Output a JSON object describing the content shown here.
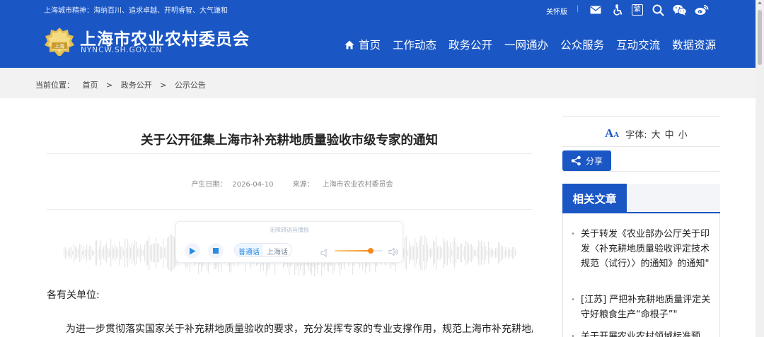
{
  "header": {
    "motto": "上海城市精神：海纳百川、追求卓越、开明睿智、大气谦和",
    "care_mode": "关怀版",
    "separator": "|",
    "icons": [
      "mail-icon",
      "accessibility-icon",
      "traditional-chinese-icon",
      "search-icon",
      "wechat-icon",
      "weibo-icon"
    ],
    "traditional_char": "繁",
    "site_title": "上海市农业农村委员会",
    "site_domain": "NYNCW.SH.GOV.CN",
    "logo_text": "上海",
    "nav": [
      "首页",
      "工作动态",
      "政务公开",
      "一网通办",
      "公众服务",
      "互动交流",
      "数据资源"
    ]
  },
  "breadcrumb": {
    "label": "当前位置：",
    "items": [
      "首页",
      "政务公开",
      "公示公告"
    ],
    "separator": ">"
  },
  "article": {
    "title": "关于公开征集上海市补充耕地质量验收市级专家的通知",
    "date_label": "产生日期：",
    "date": "2026-04-10",
    "source_label": "来源：",
    "source": "上海市农业农村委员会",
    "salutation": "各有关单位:",
    "paragraph": "为进一步贯彻落实国家关于补充耕地质量验收的要求，充分发挥专家的专业支撑作用，规范上海市补充耕地质"
  },
  "player": {
    "title": "无障碍语音播报",
    "languages": [
      "普通话",
      "上海话"
    ],
    "active_language": "普通话",
    "volume": 0.75
  },
  "sidebar": {
    "font_label": "字体:",
    "font_sizes": [
      "大",
      "中",
      "小"
    ],
    "share_label": "分享",
    "related_title": "相关文章",
    "related": [
      {
        "bullet": "•",
        "text": "关于转发《农业部办公厅关于印发〈补充耕地质量验收评定技术规范（试行）〉的通知》的通知\""
      },
      {
        "bullet": "•",
        "text": "[江苏] 严把补充耕地质量评定关 守好粮食生产“命根子”\""
      },
      {
        "bullet": "•",
        "text": "关于开展农业农村领域标准预"
      }
    ]
  },
  "colors": {
    "brand_blue": "#1a56c4",
    "volume_orange": "#f38a1c"
  }
}
